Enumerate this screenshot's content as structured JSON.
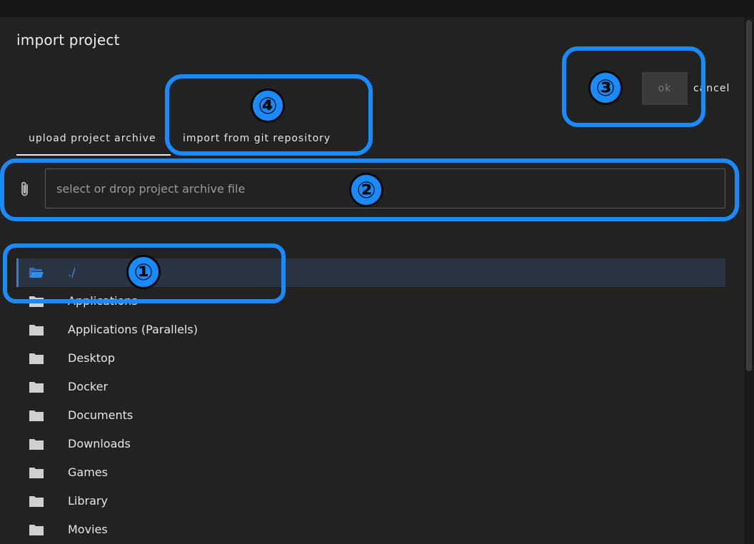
{
  "dialog": {
    "title": "import project",
    "ok_label": "ok",
    "cancel_label": "cancel"
  },
  "tabs": [
    {
      "label": "upload project archive",
      "active": true
    },
    {
      "label": "import from git repository",
      "active": false
    }
  ],
  "file_input": {
    "placeholder": "select or drop project archive file",
    "value": ""
  },
  "files": [
    {
      "name": "./",
      "selected": true
    },
    {
      "name": "Applications",
      "selected": false
    },
    {
      "name": "Applications (Parallels)",
      "selected": false
    },
    {
      "name": "Desktop",
      "selected": false
    },
    {
      "name": "Docker",
      "selected": false
    },
    {
      "name": "Documents",
      "selected": false
    },
    {
      "name": "Downloads",
      "selected": false
    },
    {
      "name": "Games",
      "selected": false
    },
    {
      "name": "Library",
      "selected": false
    },
    {
      "name": "Movies",
      "selected": false
    }
  ],
  "annotations": [
    "①",
    "②",
    "③",
    "④"
  ],
  "colors": {
    "accent": "#2f8ff0",
    "callout": "#1a8bff",
    "background": "#222222"
  }
}
